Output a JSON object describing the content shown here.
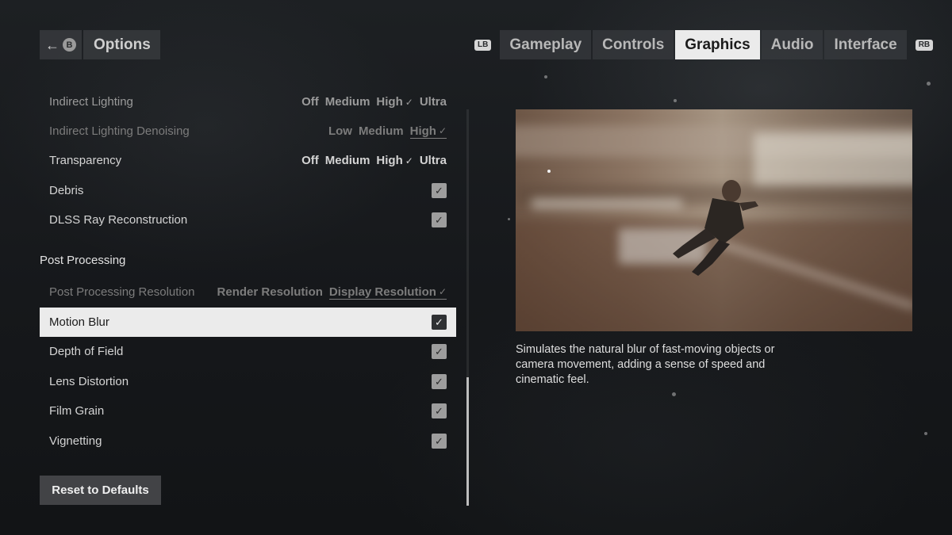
{
  "header": {
    "back_icon": "arrow-left-icon",
    "back_button_glyph": "B",
    "title": "Options"
  },
  "tabs": {
    "left_bumper": "LB",
    "right_bumper": "RB",
    "items": [
      {
        "label": "Gameplay",
        "active": false
      },
      {
        "label": "Controls",
        "active": false
      },
      {
        "label": "Graphics",
        "active": true
      },
      {
        "label": "Audio",
        "active": false
      },
      {
        "label": "Interface",
        "active": false
      }
    ]
  },
  "settings": {
    "indirect_lighting": {
      "label": "Indirect Lighting",
      "options": [
        "Off",
        "Medium",
        "High",
        "Ultra"
      ],
      "selected": "High"
    },
    "indirect_lighting_denoising": {
      "label": "Indirect Lighting Denoising",
      "options": [
        "Low",
        "Medium",
        "High"
      ],
      "selected": "High"
    },
    "transparency": {
      "label": "Transparency",
      "options": [
        "Off",
        "Medium",
        "High",
        "Ultra"
      ],
      "selected": "High"
    },
    "debris": {
      "label": "Debris",
      "checked": true
    },
    "dlss_ray_reconstruction": {
      "label": "DLSS Ray Reconstruction",
      "checked": true
    },
    "post_processing_header": "Post Processing",
    "post_processing_resolution": {
      "label": "Post Processing Resolution",
      "options": [
        "Render Resolution",
        "Display Resolution"
      ],
      "selected": "Display Resolution"
    },
    "motion_blur": {
      "label": "Motion Blur",
      "checked": true,
      "focused": true
    },
    "depth_of_field": {
      "label": "Depth of Field",
      "checked": true
    },
    "lens_distortion": {
      "label": "Lens Distortion",
      "checked": true
    },
    "film_grain": {
      "label": "Film Grain",
      "checked": true
    },
    "vignetting": {
      "label": "Vignetting",
      "checked": true
    }
  },
  "reset_button": "Reset to Defaults",
  "preview": {
    "description": "Simulates the natural blur of fast-moving objects or camera movement, adding a sense of speed and cinematic feel."
  },
  "colors": {
    "accent_selected_bg": "#ebebeb",
    "panel_bg": "#373a3d",
    "text_primary": "#d4d4d4",
    "text_disabled": "#7c7c7c"
  }
}
